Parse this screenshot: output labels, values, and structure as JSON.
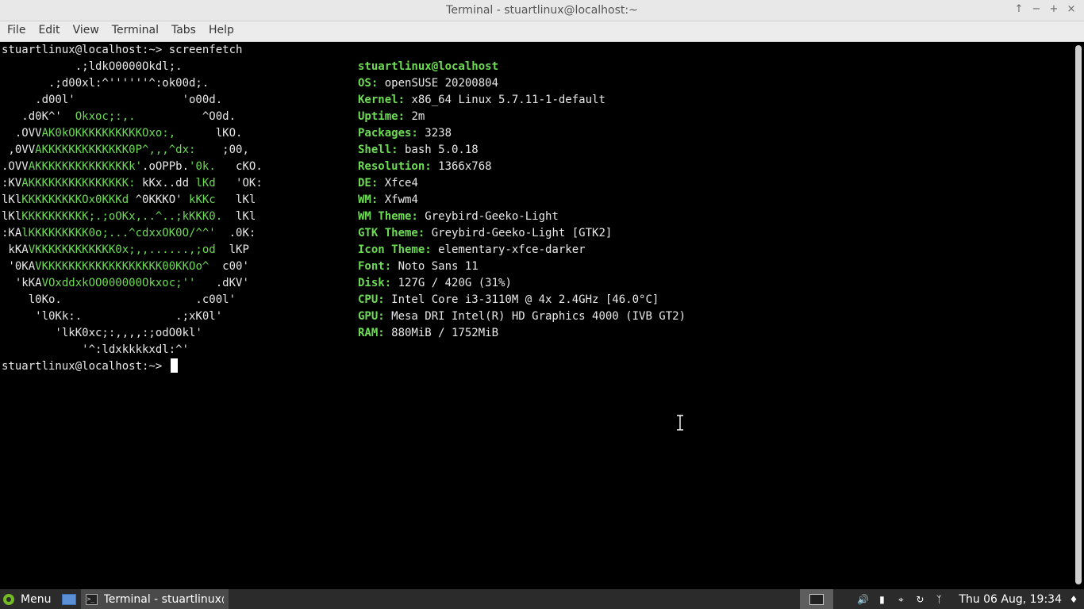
{
  "window": {
    "title": "Terminal - stuartlinux@localhost:~",
    "buttons": [
      "↑",
      "−",
      "+",
      "×"
    ]
  },
  "menubar": [
    "File",
    "Edit",
    "View",
    "Terminal",
    "Tabs",
    "Help"
  ],
  "terminal": {
    "prompt": "stuartlinux@localhost:~> ",
    "command": "screenfetch",
    "logo": [
      [
        [
          "w",
          "           .;ldkO0000Okdl;."
        ]
      ],
      [
        [
          "w",
          "       .;d00xl:^''''''^:ok00d;."
        ]
      ],
      [
        [
          "w",
          "     .d00l'                'o00d."
        ]
      ],
      [
        [
          "w",
          "   .d0K^'  "
        ],
        [
          "g",
          "Okxoc;:,."
        ],
        [
          "w",
          "          ^O0d."
        ]
      ],
      [
        [
          "w",
          "  .OVV"
        ],
        [
          "g",
          "AK0kOKKKKKKKKKKOxo:,"
        ],
        [
          "w",
          "      lKO."
        ]
      ],
      [
        [
          "w",
          " ,0VV"
        ],
        [
          "g",
          "AKKKKKKKKKKKKK0P^,,,^dx:"
        ],
        [
          "w",
          "    ;00,"
        ]
      ],
      [
        [
          "w",
          ".OVV"
        ],
        [
          "g",
          "AKKKKKKKKKKKKKKk'"
        ],
        [
          "w",
          ".oOPPb."
        ],
        [
          "g",
          "'0k."
        ],
        [
          "w",
          "   cKO."
        ]
      ],
      [
        [
          "w",
          ":KV"
        ],
        [
          "g",
          "AKKKKKKKKKKKKKKK:"
        ],
        [
          "w",
          " kKx..dd "
        ],
        [
          "g",
          "lKd"
        ],
        [
          "w",
          "   'OK:"
        ]
      ],
      [
        [
          "w",
          "lKl"
        ],
        [
          "g",
          "KKKKKKKKKOx0KKKd"
        ],
        [
          "w",
          " ^0KKKO' "
        ],
        [
          "g",
          "kKKc"
        ],
        [
          "w",
          "   lKl"
        ]
      ],
      [
        [
          "w",
          "lKl"
        ],
        [
          "g",
          "KKKKKKKKKK;.;oOKx,..^..;kKKK0."
        ],
        [
          "w",
          "  lKl"
        ]
      ],
      [
        [
          "w",
          ":KA"
        ],
        [
          "g",
          "lKKKKKKKKK0o;...^cdxxOK0O/^^'"
        ],
        [
          "w",
          "  .0K:"
        ]
      ],
      [
        [
          "w",
          " kKA"
        ],
        [
          "g",
          "VKKKKKKKKKKKK0x;,,......,;od"
        ],
        [
          "w",
          "  lKP"
        ]
      ],
      [
        [
          "w",
          " '0KA"
        ],
        [
          "g",
          "VKKKKKKKKKKKKKKKKKK00KKOo^"
        ],
        [
          "w",
          "  c00'"
        ]
      ],
      [
        [
          "w",
          "  'kKA"
        ],
        [
          "g",
          "VOxddxkOO000000Okxoc;''"
        ],
        [
          "w",
          "   .dKV'"
        ]
      ],
      [
        [
          "w",
          "    l0Ko.                    .c00l'"
        ]
      ],
      [
        [
          "w",
          "     'l0Kk:.              .;xK0l'"
        ]
      ],
      [
        [
          "w",
          "        'lkK0xc;:,,,,:;odO0kl'"
        ]
      ],
      [
        [
          "w",
          "            '^:ldxkkkkxdl:^'"
        ]
      ]
    ],
    "info_header": "stuartlinux@localhost",
    "info": [
      {
        "key": "OS:",
        "value": " openSUSE 20200804"
      },
      {
        "key": "Kernel:",
        "value": " x86_64 Linux 5.7.11-1-default"
      },
      {
        "key": "Uptime:",
        "value": " 2m"
      },
      {
        "key": "Packages:",
        "value": " 3238"
      },
      {
        "key": "Shell:",
        "value": " bash 5.0.18"
      },
      {
        "key": "Resolution:",
        "value": " 1366x768"
      },
      {
        "key": "DE:",
        "value": " Xfce4"
      },
      {
        "key": "WM:",
        "value": " Xfwm4"
      },
      {
        "key": "WM Theme:",
        "value": " Greybird-Geeko-Light"
      },
      {
        "key": "GTK Theme:",
        "value": " Greybird-Geeko-Light [GTK2]"
      },
      {
        "key": "Icon Theme:",
        "value": " elementary-xfce-darker"
      },
      {
        "key": "Font:",
        "value": " Noto Sans 11"
      },
      {
        "key": "Disk:",
        "value": " 127G / 420G (31%)"
      },
      {
        "key": "CPU:",
        "value": " Intel Core i3-3110M @ 4x 2.4GHz [46.0°C]"
      },
      {
        "key": "GPU:",
        "value": " Mesa DRI Intel(R) HD Graphics 4000 (IVB GT2)"
      },
      {
        "key": "RAM:",
        "value": " 880MiB / 1752MiB"
      }
    ]
  },
  "colors": {
    "accent_green": "#6ddb55",
    "text": "#e8e8e8",
    "background": "#000000",
    "taskbar": "#2b2b2b"
  },
  "taskbar": {
    "menu_label": "Menu",
    "task_label": "Terminal - stuartlinux@...",
    "clock": "Thu 06 Aug, 19:34",
    "tray_icons": [
      "volume-icon",
      "battery-icon",
      "wifi-icon",
      "sync-icon",
      "bluetooth-icon",
      "bell-icon"
    ]
  }
}
